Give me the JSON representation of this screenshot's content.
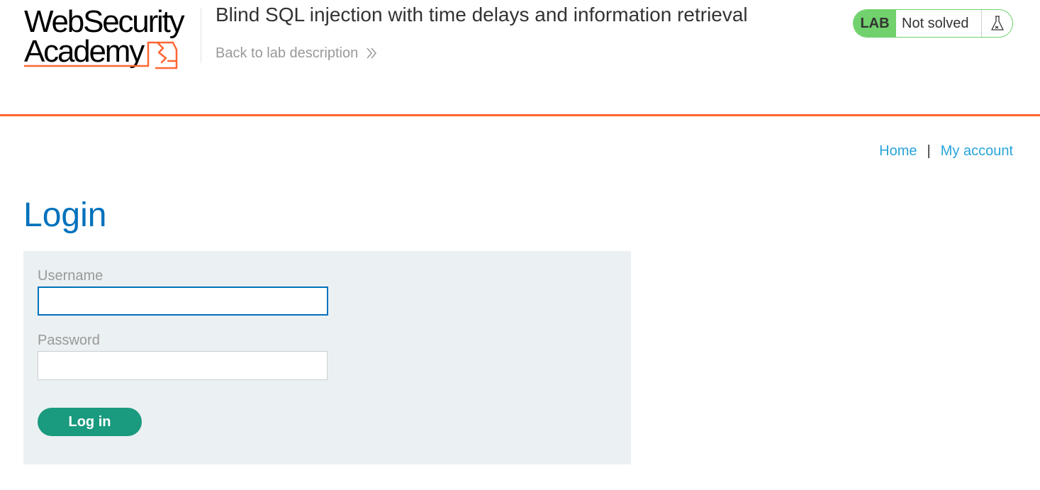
{
  "header": {
    "logo_line1": "WebSecurity",
    "logo_line2": "Academy",
    "lab_title": "Blind SQL injection with time delays and information retrieval",
    "back_link": "Back to lab description",
    "lab_badge": "LAB",
    "lab_state": "Not solved"
  },
  "nav": {
    "home": "Home",
    "separator": "|",
    "my_account": "My account"
  },
  "page": {
    "title": "Login"
  },
  "form": {
    "username_label": "Username",
    "username_value": "",
    "password_label": "Password",
    "password_value": "",
    "submit_label": "Log in"
  },
  "colors": {
    "accent_orange": "#ff6633",
    "lab_green": "#70d16d",
    "title_blue": "#0071bc",
    "link_blue": "#29a3db",
    "button_teal": "#1a9a7e",
    "panel_bg": "#ebf0f2"
  },
  "icons": {
    "back_chevron": "double-chevron-right-icon",
    "flask": "flask-icon",
    "logo_mark": "academy-logo-mark"
  }
}
